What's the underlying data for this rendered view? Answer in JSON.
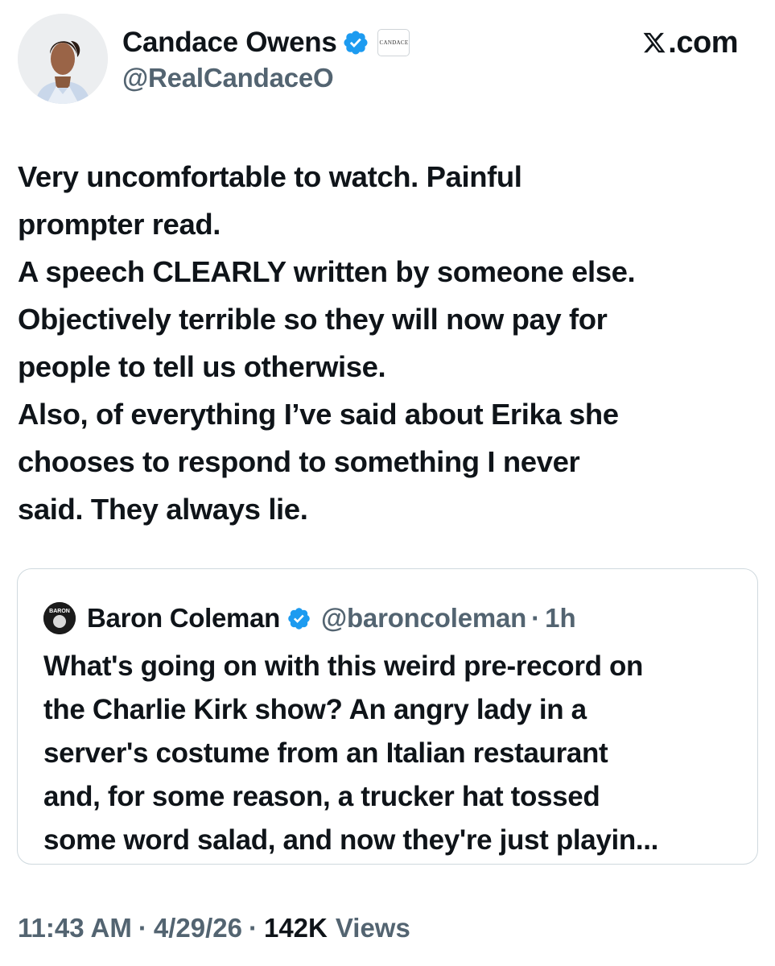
{
  "author": {
    "display_name": "Candace Owens",
    "handle": "@RealCandaceO",
    "affiliate_badge_text": "CANDACE"
  },
  "brand": {
    "site": ".com",
    "logo_icon": "x-logo-icon"
  },
  "tweet": {
    "lines": [
      "Very uncomfortable to watch. Painful",
      "prompter read.",
      "A speech CLEARLY written by someone else.",
      "Objectively terrible so they will now pay for",
      "people to tell us otherwise.",
      "Also, of everything I’ve said about Erika she",
      "chooses to respond to something I never",
      "said. They always lie."
    ]
  },
  "quoted_tweet": {
    "display_name": "Baron Coleman",
    "handle": "@baroncoleman",
    "separator": "·",
    "time": "1h",
    "avatar_text": "BARON",
    "lines": [
      "What's going on with this weird pre-record on",
      "the Charlie Kirk show?  An angry lady in a",
      "server's costume from an Italian restaurant",
      "and, for some reason, a trucker hat tossed",
      "some word salad, and now they're just playin..."
    ]
  },
  "footer": {
    "time": "11:43 AM",
    "sep1": "·",
    "date": "4/29/26",
    "sep2": "·",
    "views_count": "142K",
    "views_label": "Views"
  },
  "colors": {
    "text_primary": "#0f1419",
    "text_secondary": "#536471",
    "verified_blue": "#1d9bf0",
    "border": "#cfd9de"
  }
}
